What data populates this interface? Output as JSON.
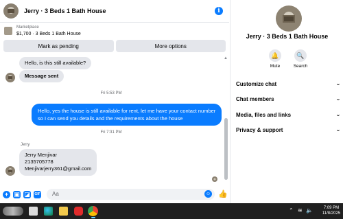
{
  "chat": {
    "title": "Jerry · 3 Beds 1 Bath House",
    "info_icon": "i"
  },
  "marketplace": {
    "label": "Marketplace",
    "listing": "$1,700 · 3 Beds 1 Bath House",
    "pending_button": "Mark as pending",
    "more_button": "More options"
  },
  "messages": {
    "msg1": "Hello, is this still available?",
    "msg2": "Message sent",
    "time1": "Fri 5:53 PM",
    "outgoing_line1": "Hello, yes the house is still available for rent, let me have your contact number",
    "outgoing_line2": "so I can send you details and the requirements about the house",
    "time2": "Fri 7:31 PM",
    "sender": "Jerry",
    "contact_line1": "Jerry Menjivar",
    "contact_line2": "2135705778",
    "contact_line3": "Menjivarjerry361@gmail.com"
  },
  "composer": {
    "placeholder": "Aa",
    "icons": [
      "plus-icon",
      "photo-icon",
      "sticker-icon",
      "gif-icon",
      "emoji-icon",
      "thumbs-up-icon"
    ]
  },
  "info_panel": {
    "name": "Jerry · 3 Beds 1 Bath House",
    "mute_label": "Mute",
    "search_label": "Search",
    "sections": [
      "Customize chat",
      "Chat members",
      "Media, files and links",
      "Privacy & support"
    ]
  },
  "taskbar": {
    "time": "7:09 PM",
    "date": "11/8/2025",
    "apps": [
      "task-view",
      "edge",
      "file-explorer",
      "youtube",
      "chrome"
    ],
    "accent": "#0a7cff"
  }
}
